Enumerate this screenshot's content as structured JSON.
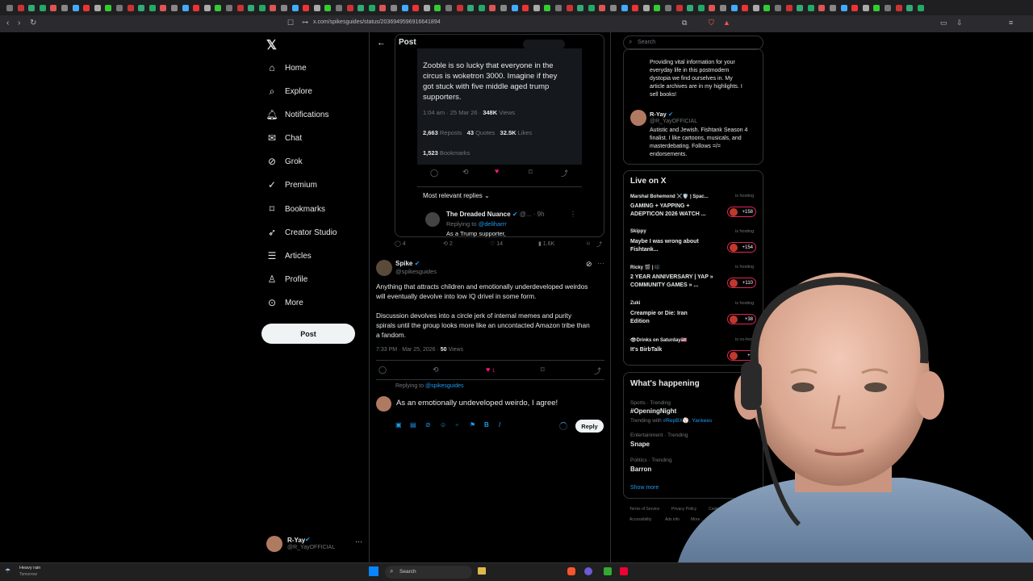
{
  "browser": {
    "url": "x.com/spikesguides/status/2036949596916641894"
  },
  "nav": {
    "items": [
      {
        "label": "Home",
        "icon": "home-icon"
      },
      {
        "label": "Explore",
        "icon": "search-icon"
      },
      {
        "label": "Notifications",
        "icon": "bell-icon"
      },
      {
        "label": "Chat",
        "icon": "chat-icon"
      },
      {
        "label": "Grok",
        "icon": "grok-icon"
      },
      {
        "label": "Premium",
        "icon": "premium-icon"
      },
      {
        "label": "Bookmarks",
        "icon": "bookmark-icon"
      },
      {
        "label": "Creator Studio",
        "icon": "rocket-icon"
      },
      {
        "label": "Articles",
        "icon": "articles-icon"
      },
      {
        "label": "Profile",
        "icon": "person-icon"
      },
      {
        "label": "More",
        "icon": "more-icon"
      }
    ],
    "post_label": "Post",
    "account": {
      "name": "R-Yay",
      "handle": "@R_YayOFFICIAL"
    }
  },
  "header": {
    "title": "Post"
  },
  "quoted": {
    "text_lines": [
      "Zooble is so lucky that everyone in the",
      "circus is woketron 3000. Imagine if they",
      "got stuck with five middle aged trump",
      "supporters."
    ],
    "meta": "1:04 am · 25 Mar 26 · ",
    "views": "348K",
    "views_label": "Views",
    "reposts": "2,663",
    "reposts_label": "Reposts",
    "quotes": "43",
    "quotes_label": "Quotes",
    "likes": "32.5K",
    "likes_label": "Likes",
    "bookmarks": "1,523",
    "bookmarks_label": "Bookmarks",
    "sort_label": "Most relevant replies",
    "reply_author": "The Dreaded Nuance",
    "reply_meta": "@... · 9h",
    "reply_replying": "Replying to ",
    "reply_replying_handle": "@deliharrr",
    "reply_text": "As a Trump supporter,",
    "outer_counts": {
      "replies": "4",
      "reposts": "2",
      "likes": "14",
      "views": "1.6K"
    }
  },
  "post": {
    "author": "Spike",
    "handle": "@spikesguides",
    "para1_lines": [
      "Anything that attracts children and emotionally underdeveloped weirdos",
      "will eventually devolve into low IQ drivel in some form."
    ],
    "para2_lines": [
      "Discussion devolves into a circle jerk of internal memes and purity",
      "spirals until the group looks more like an uncontacted Amazon tribe than",
      "a fandom."
    ],
    "timestamp": "7:33 PM · Mar 25, 2026 · ",
    "views": "50",
    "views_label": "Views",
    "likes": "1"
  },
  "reply_box": {
    "replying_to": "Replying to ",
    "replying_handle": "@spikesguides",
    "text": "As an emotionally undeveloped weirdo, I agree!",
    "reply_label": "Reply"
  },
  "right": {
    "search_placeholder": "Search",
    "bio_lines": [
      "Providing vital information for your",
      "everyday life in this postmodern",
      "dystopia we find ourselves in. My",
      "article archives are in my highlights. I",
      "sell books!"
    ],
    "who": {
      "name": "R-Yay",
      "handle": "@R_YayOFFICIAL",
      "bio_lines": [
        "Autistic and Jewish. Fishtank Season 4",
        "finalist. I like cartoons, musicals, and",
        "masterdebating. Follows =/=",
        "endorsements."
      ]
    },
    "live": {
      "title": "Live on X",
      "items": [
        {
          "host": "Marshal Bohemond ⚔️🛡️ | Spac...",
          "status": "is hosting",
          "title_lines": [
            "GAMING + YAPPING +",
            "ADEPTICON 2026 WATCH ..."
          ],
          "count": "+158"
        },
        {
          "host": "Skippy",
          "status": "is hosting",
          "title_lines": [
            "Maybe I was wrong about",
            "Fishtank..."
          ],
          "count": "+154"
        },
        {
          "host": "Ricky 🎬 | 🎼",
          "status": "is hosting",
          "title_lines": [
            "2 YEAR ANNIVERSARY | YAP »",
            "COMMUNITY GAMES » ..."
          ],
          "count": "+110"
        },
        {
          "host": "Zuki",
          "status": "is hosting",
          "title_lines": [
            "Creampie or Die: Iran",
            "Edition"
          ],
          "count": "+38"
        },
        {
          "host": "👁Drinks on Saturday🇺🇸",
          "status": "is co-hosting",
          "title_lines": [
            "It's BirbTalk"
          ],
          "count": "+7"
        }
      ]
    },
    "happening": {
      "title": "What's happening",
      "items": [
        {
          "category": "Sports · Trending",
          "topic": "#OpeningNight",
          "sub": "Trending with ",
          "sub_tags": "#RepBX⚾, Yankees"
        },
        {
          "category": "Entertainment · Trending",
          "topic": "Snape"
        },
        {
          "category": "Politics · Trending",
          "topic": "Barron"
        }
      ],
      "show_more": "Show more"
    },
    "footer": [
      "Terms of Service",
      "Privacy Policy",
      "Cookie Policy",
      "Accessibility",
      "Ads info",
      "More ..."
    ]
  },
  "taskbar": {
    "weather_title": "Heavy rain",
    "weather_sub": "Tomorrow",
    "search_label": "Search"
  },
  "colors": {
    "accent": "#1d9bf0",
    "like": "#f91880",
    "live": "#e0245e"
  }
}
